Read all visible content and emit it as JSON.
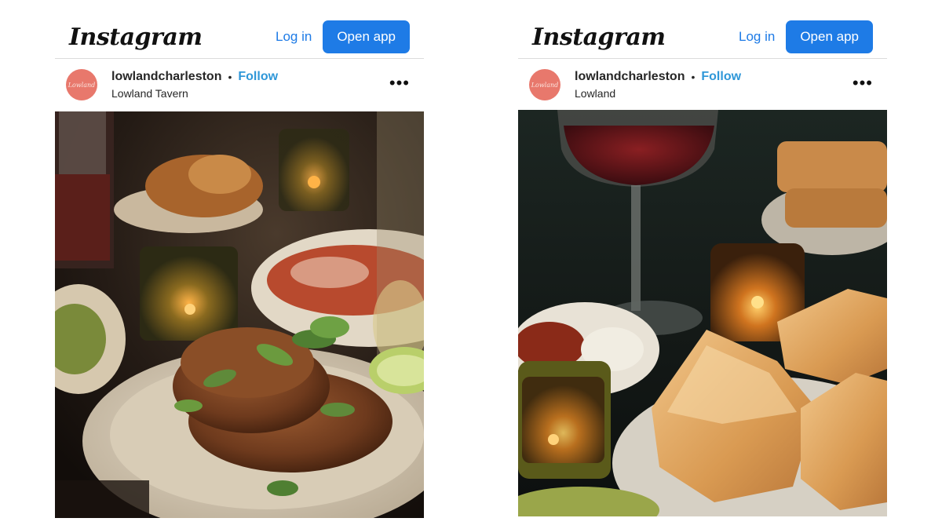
{
  "posts": [
    {
      "logo": "Instagram",
      "login": "Log in",
      "open_app": "Open app",
      "username": "lowlandcharleston",
      "separator": "•",
      "follow": "Follow",
      "location": "Lowland Tavern",
      "more": "•••",
      "avatar_text": "Lowland",
      "photo_subject": "plated fried cutlet with herbs, wine glasses and candles"
    },
    {
      "logo": "Instagram",
      "login": "Log in",
      "open_app": "Open app",
      "username": "lowlandcharleston",
      "separator": "•",
      "follow": "Follow",
      "location": "Lowland",
      "more": "•••",
      "avatar_text": "Lowland",
      "photo_subject": "biscuits on a plate with red wine, dips and candle"
    }
  ],
  "colors": {
    "accent": "#1e7be6",
    "follow": "#2f97d8",
    "avatar": "#e8786c"
  }
}
